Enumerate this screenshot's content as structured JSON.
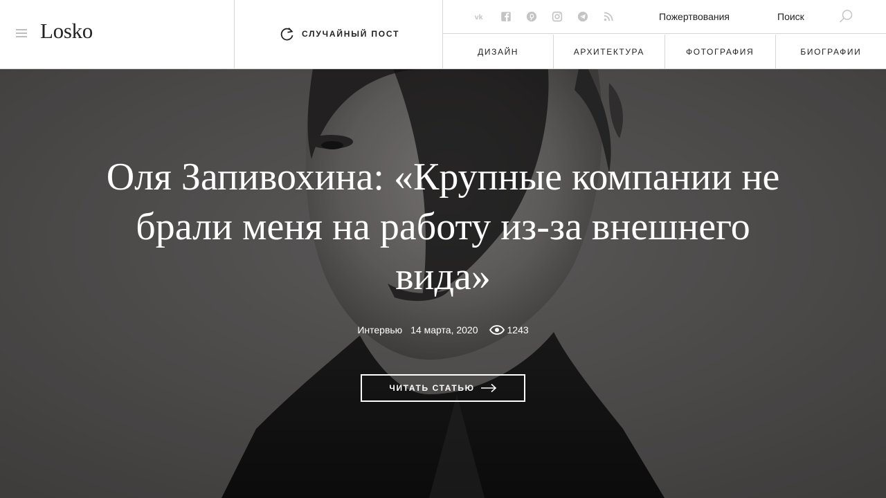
{
  "header": {
    "logo": "Losko",
    "random_post_label": "СЛУЧАЙНЫЙ ПОСТ",
    "social_icons": [
      "vk-icon",
      "facebook-icon",
      "pinterest-icon",
      "instagram-icon",
      "telegram-icon",
      "rss-icon"
    ],
    "donate_label": "Пожертвования",
    "search_label": "Поиск",
    "categories": [
      {
        "label": "ДИЗАЙН"
      },
      {
        "label": "АРХИТЕКТУРА"
      },
      {
        "label": "ФОТОГРАФИЯ"
      },
      {
        "label": "БИОГРАФИИ"
      }
    ]
  },
  "hero": {
    "title": "Оля Запивохина: «Крупные компании не брали меня на работу из-за внешнего вида»",
    "category": "Интервью",
    "date": "14 марта, 2020",
    "views": "1243",
    "read_label": "ЧИТАТЬ СТАТЬЮ"
  },
  "colors": {
    "text": "#222222",
    "border": "#d6d6d6",
    "icon_gray": "#bdbdbd",
    "hero_text": "#ffffff"
  }
}
